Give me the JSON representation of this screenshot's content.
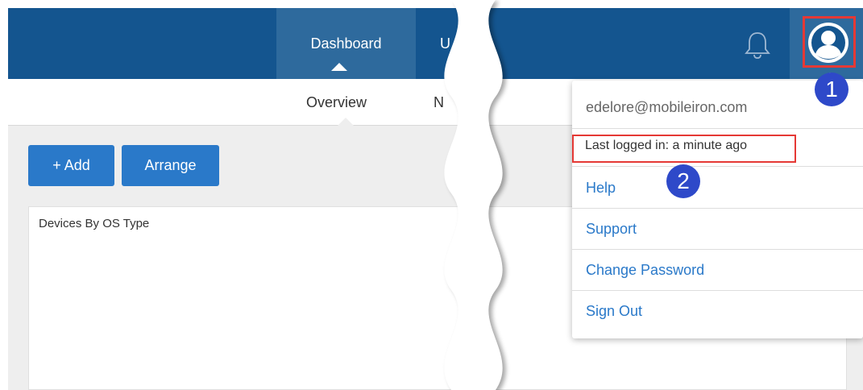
{
  "nav": {
    "tabs": [
      {
        "label": "Dashboard"
      },
      {
        "label": "U"
      }
    ]
  },
  "subnav": {
    "tabs": [
      {
        "label": "Overview"
      },
      {
        "label": "N"
      }
    ]
  },
  "toolbar": {
    "add_label": "+ Add",
    "arrange_label": "Arrange"
  },
  "panel": {
    "title": "Devices By OS Type"
  },
  "user_menu": {
    "email": "edelore@mobileiron.com",
    "last_logged_in": "Last logged in: a minute ago",
    "items": [
      {
        "label": "Help"
      },
      {
        "label": "Support"
      },
      {
        "label": "Change Password"
      },
      {
        "label": "Sign Out"
      }
    ]
  },
  "callouts": [
    "1",
    "2"
  ],
  "icons": {
    "notifications": "bell-icon",
    "user": "user-avatar-icon"
  },
  "colors": {
    "nav_bg": "#14558f",
    "nav_active": "#2e6a9d",
    "button": "#2a79c9",
    "link": "#2a79c9",
    "highlight": "#e53935",
    "callout": "#2e49c9"
  }
}
